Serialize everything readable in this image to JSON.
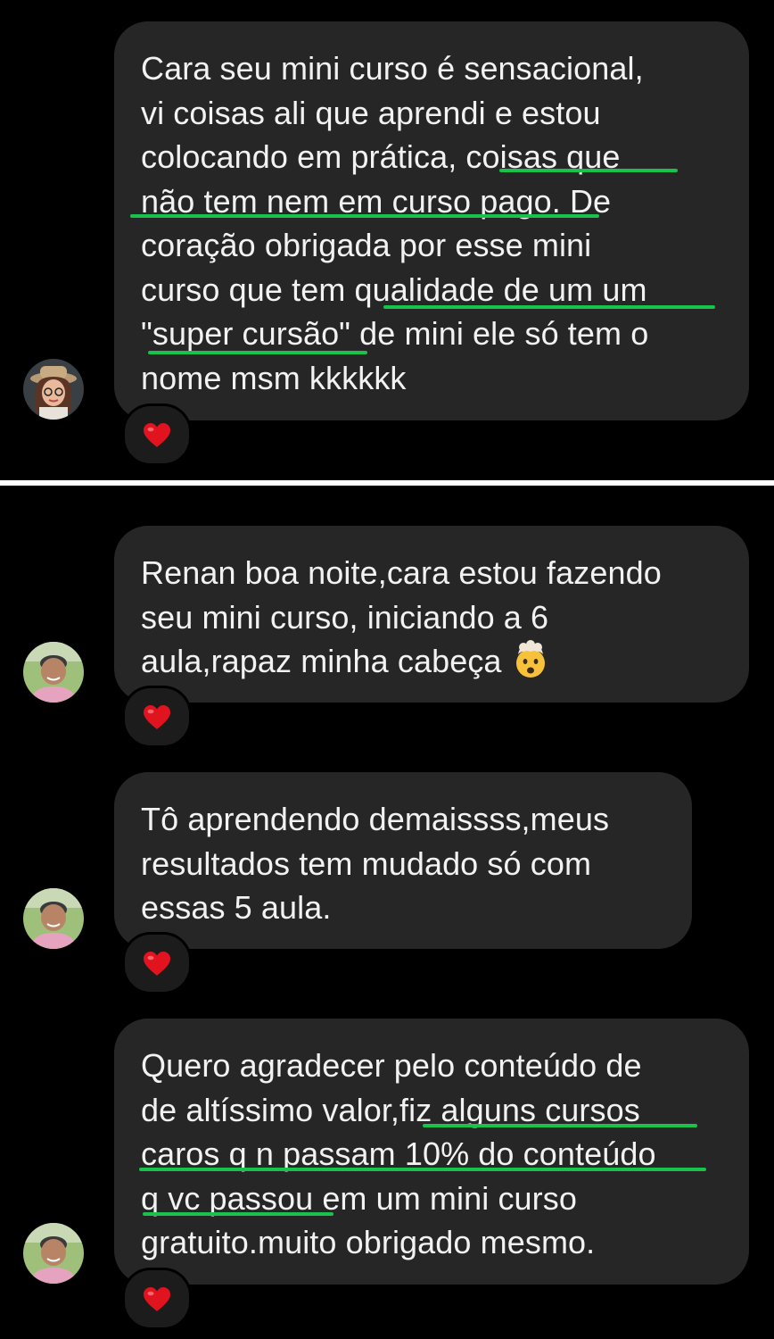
{
  "messages": [
    {
      "sender": "female",
      "text": "Cara seu mini curso é sensacional,\nvi coisas ali que aprendi e estou\ncolocando em prática, coisas que\nnão tem nem em curso pago. De\ncoração obrigada por esse mini\ncurso que tem qualidade de um um\n\"super cursão\" de mini ele só tem o\nnome msm kkkkkk",
      "reaction": "heart-icon"
    },
    {
      "sender": "male",
      "text": "Renan boa noite,cara estou fazendo\nseu mini curso, iniciando a 6\naula,rapaz minha cabeça",
      "emoji": "exploding-head-emoji",
      "reaction": "heart-icon"
    },
    {
      "sender": "male",
      "text": "Tô aprendendo demaissss,meus\nresultados tem mudado só com\nessas 5 aula.",
      "reaction": "heart-icon"
    },
    {
      "sender": "male",
      "text": "Quero agradecer pelo conteúdo de\nde altíssimo valor,fiz alguns cursos\ncaros q n passam 10% do conteúdo\nq vc passou em um mini curso\ngratuito.muito obrigado mesmo.",
      "reaction": "heart-icon"
    }
  ],
  "colors": {
    "background": "#000000",
    "bubble": "#262626",
    "text": "#f2f2f2",
    "highlight_underline": "#19c24a",
    "heart": "#e0131f",
    "divider": "#ffffff"
  }
}
